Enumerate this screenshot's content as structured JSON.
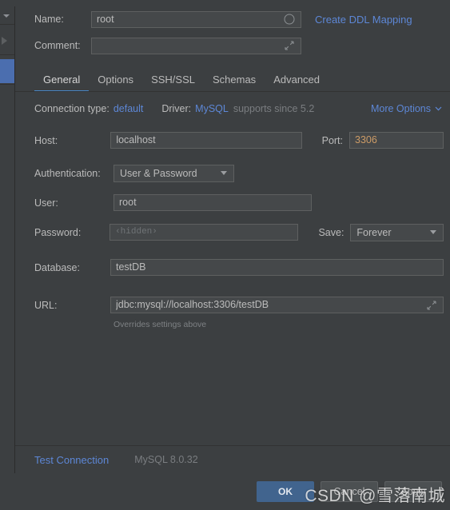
{
  "dialog": {
    "name_label": "Name:",
    "name_value": "root",
    "name_color_icon": "circle-icon",
    "create_ddl_link": "Create DDL Mapping",
    "comment_label": "Comment:",
    "comment_value": "",
    "comment_expand_icon": "expand-icon"
  },
  "tabs": [
    {
      "label": "General",
      "active": true
    },
    {
      "label": "Options",
      "active": false
    },
    {
      "label": "SSH/SSL",
      "active": false
    },
    {
      "label": "Schemas",
      "active": false
    },
    {
      "label": "Advanced",
      "active": false
    }
  ],
  "connection": {
    "type_label": "Connection type:",
    "type_value": "default",
    "driver_label": "Driver:",
    "driver_value": "MySQL",
    "driver_note": "supports since 5.2",
    "more_options_label": "More Options",
    "more_options_icon": "chevron-down-icon"
  },
  "fields": {
    "host_label": "Host:",
    "host_value": "localhost",
    "port_label": "Port:",
    "port_value": "3306",
    "auth_label": "Authentication:",
    "auth_value": "User & Password",
    "user_label": "User:",
    "user_value": "root",
    "password_label": "Password:",
    "password_placeholder": "‹hidden›",
    "save_label": "Save:",
    "save_value": "Forever",
    "database_label": "Database:",
    "database_value": "testDB",
    "url_label": "URL:",
    "url_value": "jdbc:mysql://localhost:3306/testDB",
    "url_expand_icon": "expand-icon",
    "url_hint": "Overrides settings above"
  },
  "footer": {
    "test_connection_label": "Test Connection",
    "driver_version": "MySQL 8.0.32"
  },
  "buttons": {
    "ok": "OK",
    "cancel": "Cancel",
    "apply": "Apply"
  },
  "watermark": {
    "text": "CSDN @雪落南城"
  },
  "colors": {
    "background": "#3c3f41",
    "field_background": "#45484a",
    "accent_link": "#5d87d6",
    "accent_tab_underline": "#4a88c7",
    "primary_button": "#41648e",
    "selection": "#4b6eaf",
    "value_orange": "#cc9b66"
  }
}
